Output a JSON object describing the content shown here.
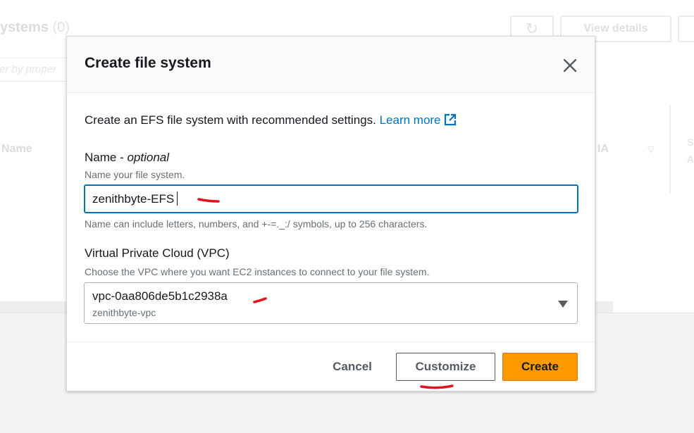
{
  "background": {
    "title": "ystems",
    "title_count": "(0)",
    "view_details_label": "View details",
    "filter_placeholder": "er by proper",
    "column_name": "Name",
    "column_ia": "IA",
    "column_sa_line1": "S",
    "column_sa_line2": "A"
  },
  "modal": {
    "title": "Create file system",
    "intro_text": "Create an EFS file system with recommended settings.",
    "learn_more_label": "Learn more",
    "name_field": {
      "label": "Name -",
      "label_optional": "optional",
      "description": "Name your file system.",
      "value": "zenithbyte-EFS",
      "hint": "Name can include letters, numbers, and +-=._:/ symbols, up to 256 characters."
    },
    "vpc_field": {
      "label": "Virtual Private Cloud (VPC)",
      "description": "Choose the VPC where you want EC2 instances to connect to your file system.",
      "selected_id": "vpc-0aa806de5b1c2938a",
      "selected_name": "zenithbyte-vpc"
    },
    "buttons": {
      "cancel": "Cancel",
      "customize": "Customize",
      "create": "Create"
    }
  },
  "colors": {
    "link": "#0073bb",
    "primary_button": "#ff9900",
    "focus_border": "#0073bb",
    "annotation": "#e0141e"
  },
  "icons": {
    "close": "close-icon",
    "external_link": "external-link-icon",
    "dropdown": "caret-down-icon",
    "refresh": "refresh-icon"
  }
}
